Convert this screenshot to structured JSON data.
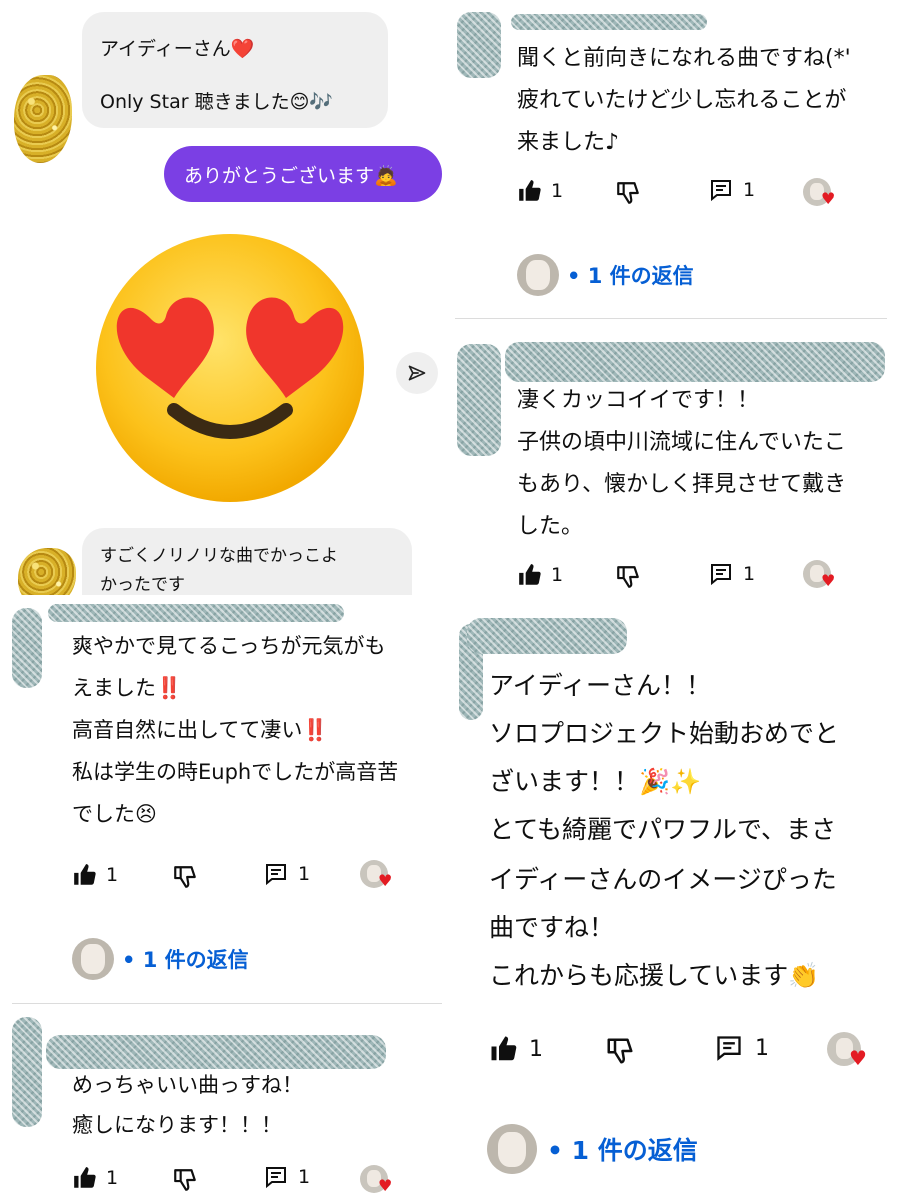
{
  "chat": {
    "msg1_line1": "アイディーさん❤️",
    "msg1_line2": "Only Star 聴きました😊🎶",
    "reply": "ありがとうございます🙇",
    "msg3_line1": "すごくノリノリな曲でかっこよ",
    "msg3_line2": "かったです",
    "send_icon": "send-icon"
  },
  "comments": [
    {
      "lines": [
        "聞くと前向きになれる曲ですね(*'",
        "疲れていたけど少し忘れることが",
        "来ました♪"
      ],
      "likes": "1",
      "replies_count": "1",
      "reply_link": "• 1 件の返信"
    },
    {
      "lines": [
        "凄くカッコイイです！！",
        "子供の頃中川流域に住んでいたこ",
        "もあり、懐かしく拝見させて戴き",
        "した。"
      ],
      "likes": "1",
      "replies_count": "1"
    },
    {
      "lines": [
        "爽やかで見てるこっちが元気がも",
        "えました‼️",
        "高音自然に出してて凄い‼️",
        "私は学生の時Euphでしたが高音苦",
        "でした😣"
      ],
      "likes": "1",
      "replies_count": "1",
      "reply_link": "• 1 件の返信"
    },
    {
      "lines": [
        "アイディーさん！！",
        "ソロプロジェクト始動おめでと",
        "ざいます！！🎉✨",
        "とても綺麗でパワフルで、まさ",
        "イディーさんのイメージぴった",
        "曲ですね！",
        "これからも応援しています👏"
      ],
      "likes": "1",
      "replies_count": "1",
      "reply_link": "• 1 件の返信"
    },
    {
      "lines": [
        "めっちゃいい曲っすね！",
        "癒しになります！！！"
      ],
      "likes": "1",
      "replies_count": "1"
    }
  ],
  "icons": {
    "like": "thumbs-up-icon",
    "dislike": "thumbs-down-icon",
    "reply": "comment-icon",
    "heart": "heart-icon"
  },
  "colors": {
    "purple_bubble": "#7b3fe4",
    "reply_link": "#065fd4",
    "heart": "#e31b23"
  }
}
